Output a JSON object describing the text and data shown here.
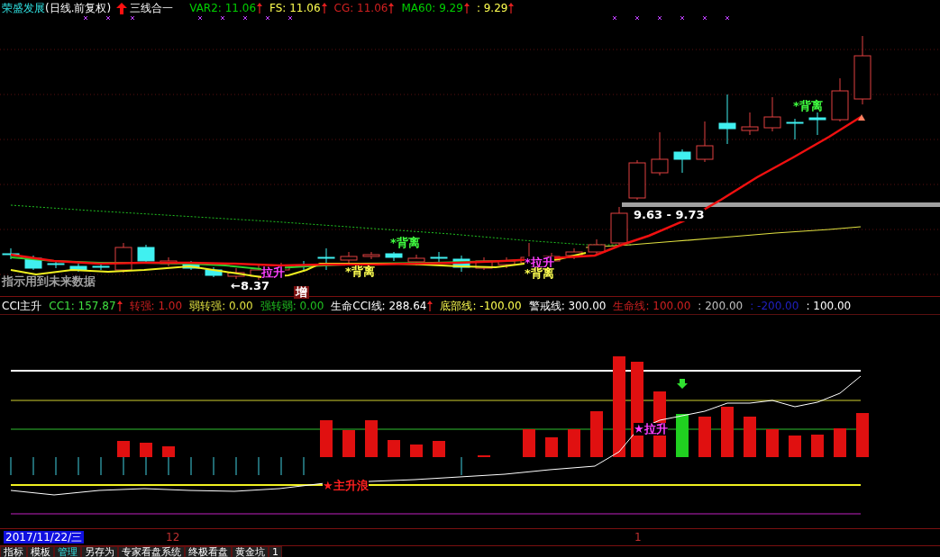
{
  "price_panel": {
    "stock": "荣盛发展",
    "period": "(日线.前复权)",
    "indicator": "三线合一",
    "legend": [
      {
        "text": "VAR2: 11.06",
        "color": "#00d000",
        "arrow": true
      },
      {
        "text": "FS: 11.06",
        "color": "#ffff50",
        "arrow": true
      },
      {
        "text": "CG: 11.06",
        "color": "#d02020",
        "arrow": true
      },
      {
        "text": "MA60: 9.29",
        "color": "#00d000",
        "arrow": true
      },
      {
        "text": ": 9.29",
        "color": "#ffff50",
        "arrow": true
      }
    ],
    "labels": [
      {
        "kind": "text",
        "text": "*背离",
        "color": "#40ff40"
      },
      {
        "kind": "text",
        "text": "9.63 - 9.73",
        "color": "#ffffff"
      },
      {
        "kind": "text",
        "text": "*背离",
        "color": "#40ff40"
      },
      {
        "kind": "signal",
        "text": "*拉升"
      },
      {
        "kind": "signal",
        "text": "拉升"
      },
      {
        "kind": "text",
        "text": "*背离",
        "color": "#ffff50"
      },
      {
        "kind": "text",
        "text": "*背离",
        "color": "#ffff50"
      },
      {
        "kind": "text",
        "text": "指示用到未来数据",
        "color": "#a0a0a0"
      },
      {
        "kind": "text",
        "text": "←8.37",
        "color": "#ffffff"
      },
      {
        "kind": "tag",
        "text": "增"
      }
    ]
  },
  "cci_panel": {
    "legend": [
      {
        "text": "CCI主升",
        "color": "#ffffff",
        "arrow": false
      },
      {
        "text": "CC1: 157.87",
        "color": "#40e040",
        "arrow": true
      },
      {
        "text": "转强: 1.00",
        "color": "#d02020",
        "arrow": false
      },
      {
        "text": "弱转强: 0.00",
        "color": "#e0e040",
        "arrow": false
      },
      {
        "text": "强转弱: 0.00",
        "color": "#20c020",
        "arrow": false
      },
      {
        "text": "生命CCI线: 288.64",
        "color": "#ffffff",
        "arrow": true
      },
      {
        "text": "底部线: -100.00",
        "color": "#ffff50",
        "arrow": false
      },
      {
        "text": "警戒线: 300.00",
        "color": "#ffffff",
        "arrow": false
      },
      {
        "text": "生命线: 100.00",
        "color": "#d02020",
        "arrow": false
      },
      {
        "text": ": 200.00",
        "color": "#c0c0c0",
        "arrow": false
      },
      {
        "text": ": -200.00",
        "color": "#2020c0",
        "arrow": false
      },
      {
        "text": ": 100.00",
        "color": "#ffffff",
        "arrow": false
      }
    ],
    "labels": [
      {
        "kind": "signal",
        "text": "★拉升"
      },
      {
        "kind": "text",
        "text": "★主升浪",
        "color": "#ff2020"
      }
    ]
  },
  "date_axis": {
    "cursor_date": "2017/11/22/三",
    "ticks": [
      "12",
      "1"
    ]
  },
  "tabs": [
    {
      "label": "指标",
      "selected": false
    },
    {
      "label": "模板",
      "selected": false
    },
    {
      "label": "管理",
      "selected": true
    },
    {
      "label": "另存为",
      "selected": false
    },
    {
      "label": "专家看盘系统",
      "selected": false
    },
    {
      "label": "终极看盘",
      "selected": false
    },
    {
      "label": "黄金坑",
      "selected": false
    },
    {
      "label": "1",
      "selected": false
    }
  ]
}
